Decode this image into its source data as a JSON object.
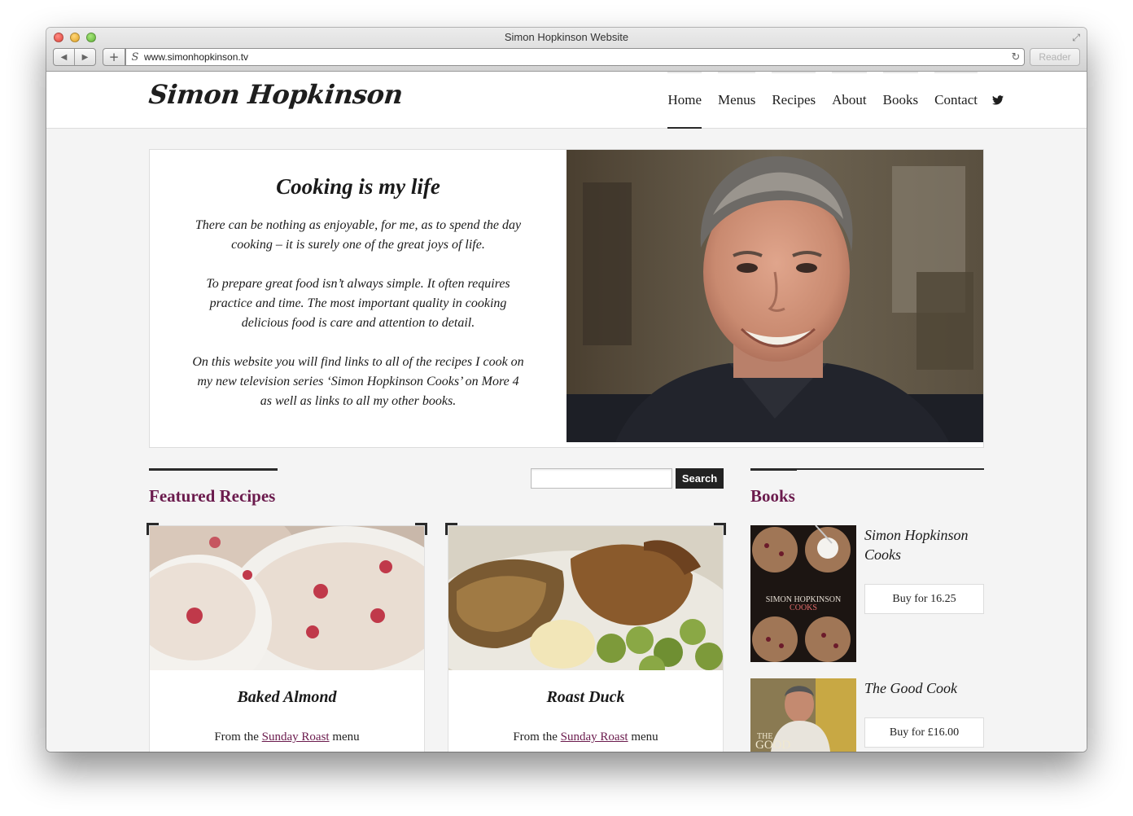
{
  "browser": {
    "window_title": "Simon Hopkinson Website",
    "url": "www.simonhopkinson.tv",
    "reader_label": "Reader",
    "back_glyph": "◀",
    "forward_glyph": "▶",
    "add_glyph": "+",
    "reload_glyph": "↻",
    "fullscreen_glyph": "⤢"
  },
  "site": {
    "logo": "Simon Hopkinson",
    "nav": [
      {
        "label": "Home",
        "active": true
      },
      {
        "label": "Menus"
      },
      {
        "label": "Recipes"
      },
      {
        "label": "About"
      },
      {
        "label": "Books"
      },
      {
        "label": "Contact"
      }
    ],
    "social_icon": "twitter-icon"
  },
  "intro": {
    "title": "Cooking is my life",
    "paragraphs": [
      "There can be nothing as enjoyable, for me, as to spend the day cooking – it is surely one of the great joys of life.",
      "To prepare great food isn’t always simple. It often requires practice and time. The most important quality in cooking delicious food is care and attention to detail.",
      "On this website you will find links to all of the recipes I cook on my new television series ‘Simon Hopkinson Cooks’ on More 4 as well as links to all my other books."
    ]
  },
  "featured": {
    "title": "Featured Recipes",
    "search_button": "Search",
    "search_value": "",
    "cards": [
      {
        "title": "Baked Almond",
        "prefix": "From the",
        "menu": "Sunday Roast",
        "suffix": "menu"
      },
      {
        "title": "Roast Duck",
        "prefix": "From the",
        "menu": "Sunday Roast",
        "suffix": "menu"
      }
    ]
  },
  "books": {
    "title": "Books",
    "items": [
      {
        "title": "Simon Hopkinson Cooks",
        "button": "Buy for 16.25",
        "cover_text": "SIMON HOPKINSON",
        "cover_subtext": "COOKS"
      },
      {
        "title": "The Good Cook",
        "button": "Buy for £16.00",
        "cover_text": "THE",
        "cover_subtext": "GOOD"
      }
    ]
  },
  "colors": {
    "accent": "#6b1b4d",
    "dark": "#2a2a2a",
    "page_bg": "#f4f4f4"
  }
}
